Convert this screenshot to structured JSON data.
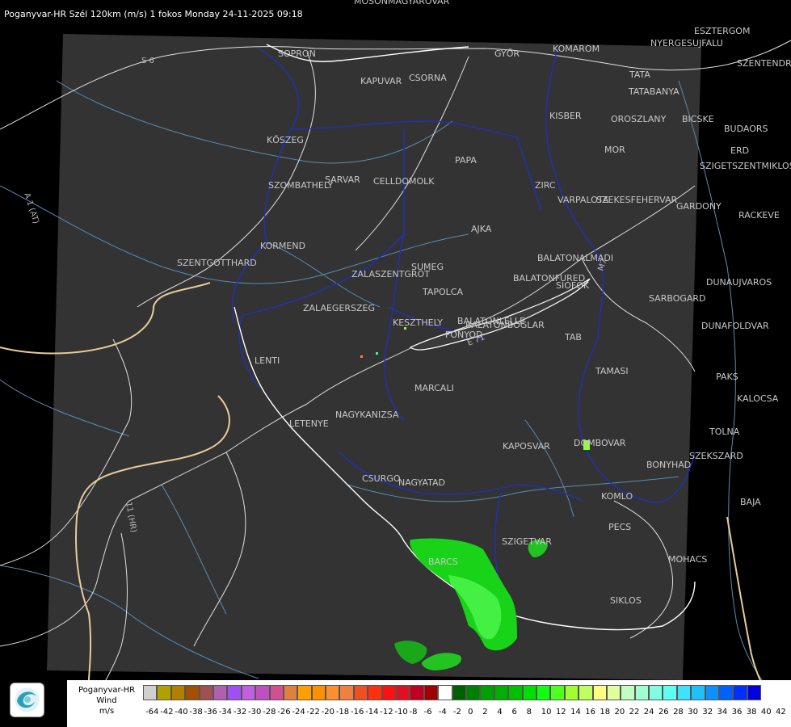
{
  "header": {
    "title": "Poganyvar-HR Szél 120km (m/s) 1 fokos Monday 24-11-2025 09:18"
  },
  "towns": [
    {
      "name": "MOSONMAGYAROVAR"
    },
    {
      "name": "SOPRON"
    },
    {
      "name": "KAPUVAR"
    },
    {
      "name": "CSORNA"
    },
    {
      "name": "GYŐR"
    },
    {
      "name": "KOMAROM"
    },
    {
      "name": "ESZTERGOM"
    },
    {
      "name": "NYERGESUJFALU"
    },
    {
      "name": "SZENTENDRE"
    },
    {
      "name": "TATA"
    },
    {
      "name": "TATABANYA"
    },
    {
      "name": "KISBER"
    },
    {
      "name": "OROSZLANY"
    },
    {
      "name": "BICSKE"
    },
    {
      "name": "BUDAORS"
    },
    {
      "name": "ERD"
    },
    {
      "name": "SZIGETSZENTMIKLOS"
    },
    {
      "name": "MOR"
    },
    {
      "name": "PAPA"
    },
    {
      "name": "KŐSZEG"
    },
    {
      "name": "SARVAR"
    },
    {
      "name": "CELLDOMOLK"
    },
    {
      "name": "SZOMBATHELY"
    },
    {
      "name": "ZIRC"
    },
    {
      "name": "VARPALOTA"
    },
    {
      "name": "SZEKESFEHERVAR"
    },
    {
      "name": "GARDONY"
    },
    {
      "name": "RACKEVE"
    },
    {
      "name": "AJKA"
    },
    {
      "name": "KORMEND"
    },
    {
      "name": "SZENTGOTTHARD"
    },
    {
      "name": "SUMEG"
    },
    {
      "name": "ZALASZENTGROT"
    },
    {
      "name": "BALATONALMADI"
    },
    {
      "name": "BALATONFURED"
    },
    {
      "name": "TAPOLCA"
    },
    {
      "name": "SIOFOK"
    },
    {
      "name": "DUNAUJVAROS"
    },
    {
      "name": "ZALAEGERSZEG"
    },
    {
      "name": "SARBOGARD"
    },
    {
      "name": "KESZTHELY"
    },
    {
      "name": "BALATONLELLE"
    },
    {
      "name": "FONYOD"
    },
    {
      "name": "BALATONBOGLAR"
    },
    {
      "name": "DUNAFOLDVAR"
    },
    {
      "name": "TAB"
    },
    {
      "name": "LENTI"
    },
    {
      "name": "TAMASI"
    },
    {
      "name": "PAKS"
    },
    {
      "name": "MARCALI"
    },
    {
      "name": "KALOCSA"
    },
    {
      "name": "LETENYE"
    },
    {
      "name": "NAGYKANIZSA"
    },
    {
      "name": "TOLNA"
    },
    {
      "name": "KAPOSVAR"
    },
    {
      "name": "DOMBOVAR"
    },
    {
      "name": "SZEKSZARD"
    },
    {
      "name": "BONYHAD"
    },
    {
      "name": "CSURGO"
    },
    {
      "name": "NAGYATAD"
    },
    {
      "name": "KOMLO"
    },
    {
      "name": "BAJA"
    },
    {
      "name": "PECS"
    },
    {
      "name": "SZIGETVAR"
    },
    {
      "name": "BARCS"
    },
    {
      "name": "MOHACS"
    },
    {
      "name": "SIKLOS"
    }
  ],
  "roads": [
    {
      "label": "S 6"
    },
    {
      "label": "A 1 (AT)"
    },
    {
      "label": "11 (HR)"
    },
    {
      "label": "M7"
    },
    {
      "label": "E 71"
    }
  ],
  "legend": {
    "title_line1": "Poganyvar-HR",
    "title_line2": "Wind",
    "title_line3": "m/s",
    "ticks": [
      "-64",
      "-42",
      "-40",
      "-38",
      "-36",
      "-34",
      "-32",
      "-30",
      "-28",
      "-26",
      "-24",
      "-22",
      "-20",
      "-18",
      "-16",
      "-14",
      "-12",
      "-10",
      "-8",
      "-6",
      "-4",
      "-2",
      "0",
      "2",
      "4",
      "6",
      "8",
      "10",
      "12",
      "14",
      "16",
      "18",
      "20",
      "22",
      "24",
      "26",
      "28",
      "30",
      "32",
      "34",
      "36",
      "38",
      "40",
      "42"
    ],
    "colors": [
      "#d0d0d0",
      "#b0a000",
      "#b08000",
      "#a05000",
      "#a05050",
      "#b060b0",
      "#a050f0",
      "#c060e0",
      "#c050c0",
      "#d05090",
      "#e08040",
      "#ffa000",
      "#ff9000",
      "#ff9030",
      "#f08040",
      "#f05020",
      "#ff3010",
      "#ff1010",
      "#e01020",
      "#c00020",
      "#a00000",
      "#ffffff",
      "#006000",
      "#008000",
      "#00a000",
      "#00b000",
      "#00c000",
      "#00e000",
      "#10ff10",
      "#50ff20",
      "#a0ff30",
      "#c0ff60",
      "#ffff80",
      "#e0ffa0",
      "#c0ffc0",
      "#a0ffd0",
      "#80ffe0",
      "#60fff0",
      "#40e0ff",
      "#20c0ff",
      "#1090ff",
      "#0060ff",
      "#0030ff",
      "#0000e0"
    ]
  },
  "logo": {
    "icon": "radar-logo-icon"
  }
}
